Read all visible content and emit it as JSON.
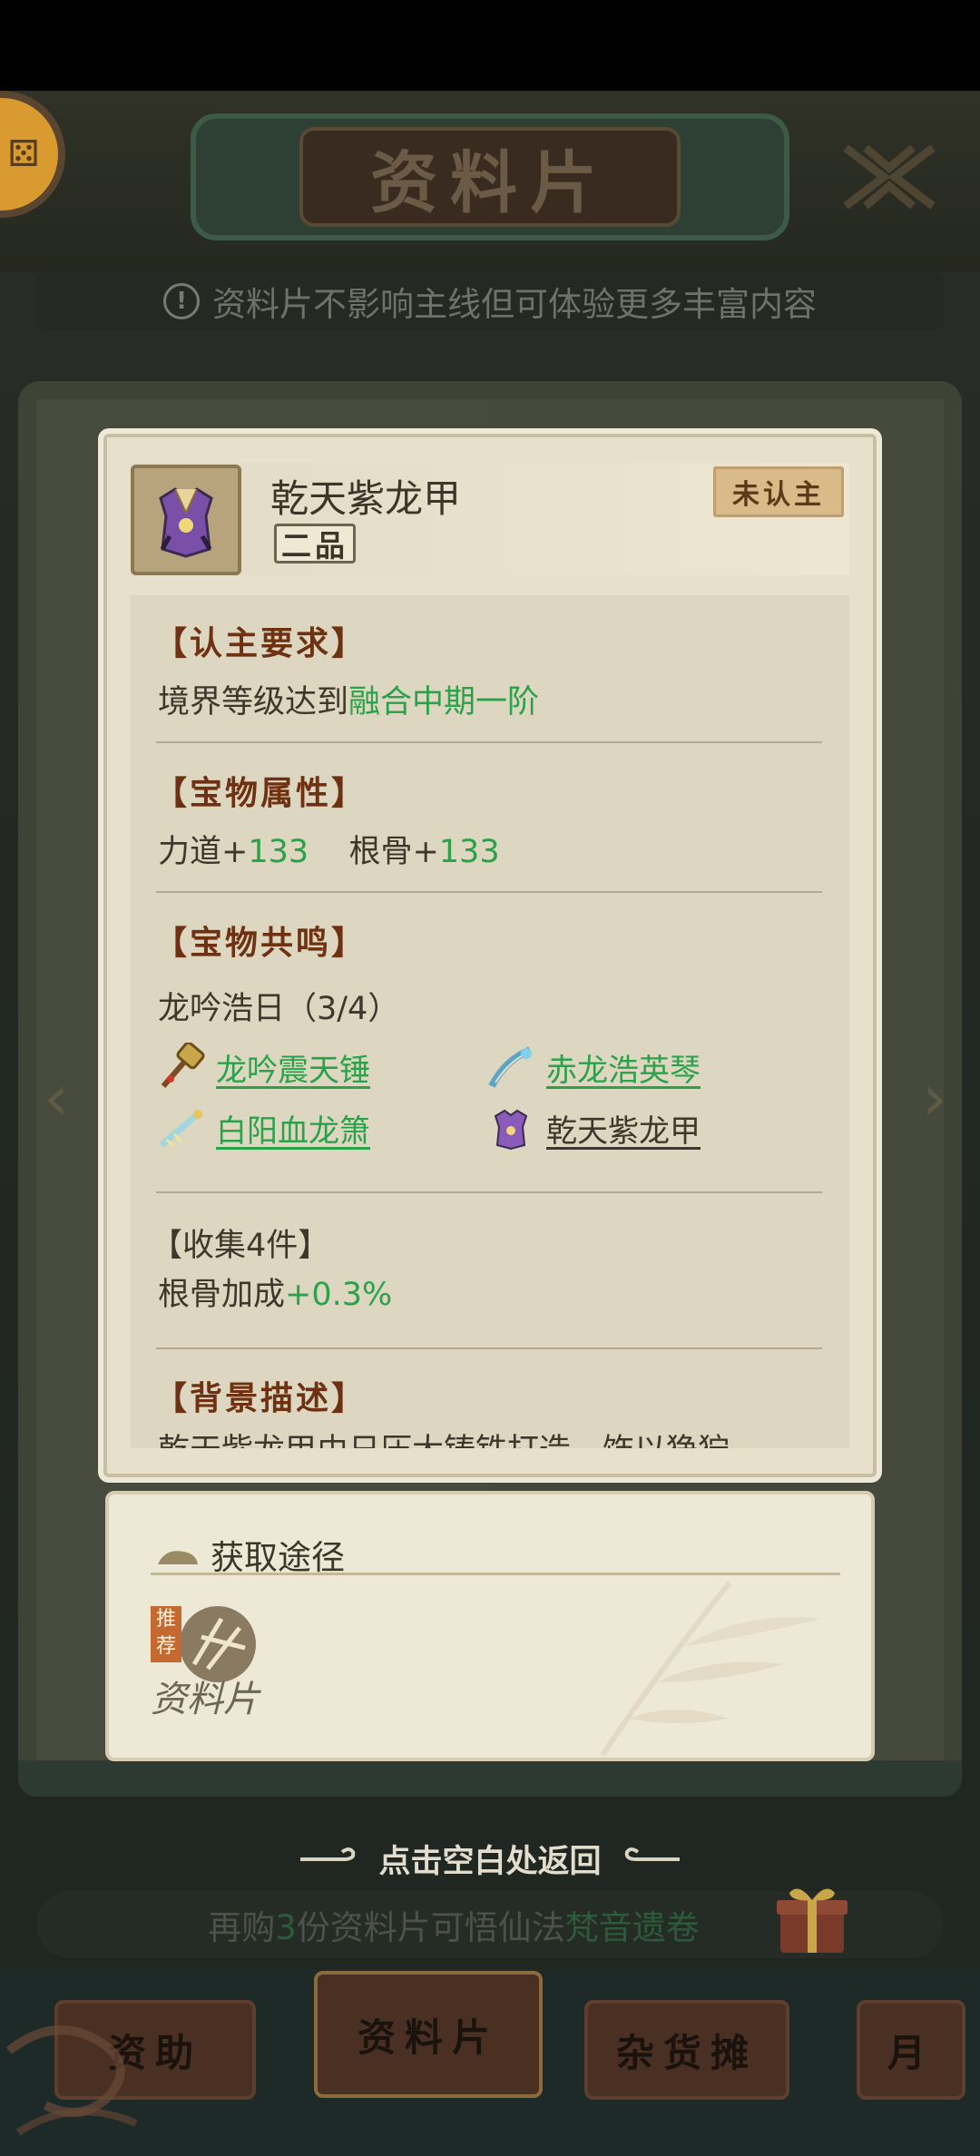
{
  "header": {
    "title": "资料片"
  },
  "notice": {
    "text": "资料片不影响主线但可体验更多丰富内容"
  },
  "item": {
    "name": "乾天紫龙甲",
    "grade": "二品",
    "status_badge": "未认主"
  },
  "requirements": {
    "title": "【认主要求】",
    "prefix": "境界等级达到",
    "realm": "融合中期一阶"
  },
  "attributes": {
    "title": "【宝物属性】",
    "stats": [
      {
        "name": "力道",
        "plus": "+",
        "value": "133"
      },
      {
        "name": "根骨",
        "plus": "+",
        "value": "133"
      }
    ]
  },
  "resonance": {
    "title": "【宝物共鸣】",
    "set_name": "龙吟浩日（3/4）",
    "items": [
      {
        "name": "龙吟震天锤",
        "owned": true,
        "icon": "hammer-icon"
      },
      {
        "name": "赤龙浩英琴",
        "owned": true,
        "icon": "zither-icon"
      },
      {
        "name": "白阳血龙箫",
        "owned": true,
        "icon": "flute-icon"
      },
      {
        "name": "乾天紫龙甲",
        "owned": false,
        "icon": "armor-icon"
      }
    ]
  },
  "collection_bonus": {
    "title": "【收集4件】",
    "prefix": "根骨加成",
    "value": "+0.3%"
  },
  "background": {
    "title": "【背景描述】",
    "text_partial": "乾天紫龙甲由日压大铸铁打造，饰以狰狞"
  },
  "acquire": {
    "title": "获取途径",
    "recommend_tag": "推荐",
    "source": "资料片"
  },
  "return_hint": "点击空白处返回",
  "promo": {
    "prefix": "再购",
    "count": "3",
    "middle": "份资料片可悟仙法",
    "spell": "梵音遗卷"
  },
  "bottom_tabs": [
    "资助",
    "资料片",
    "杂货摊",
    "月"
  ],
  "colors": {
    "accent_green": "#2aa24a",
    "title_brown": "#6e3111",
    "badge_bg": "#d8bb88"
  }
}
